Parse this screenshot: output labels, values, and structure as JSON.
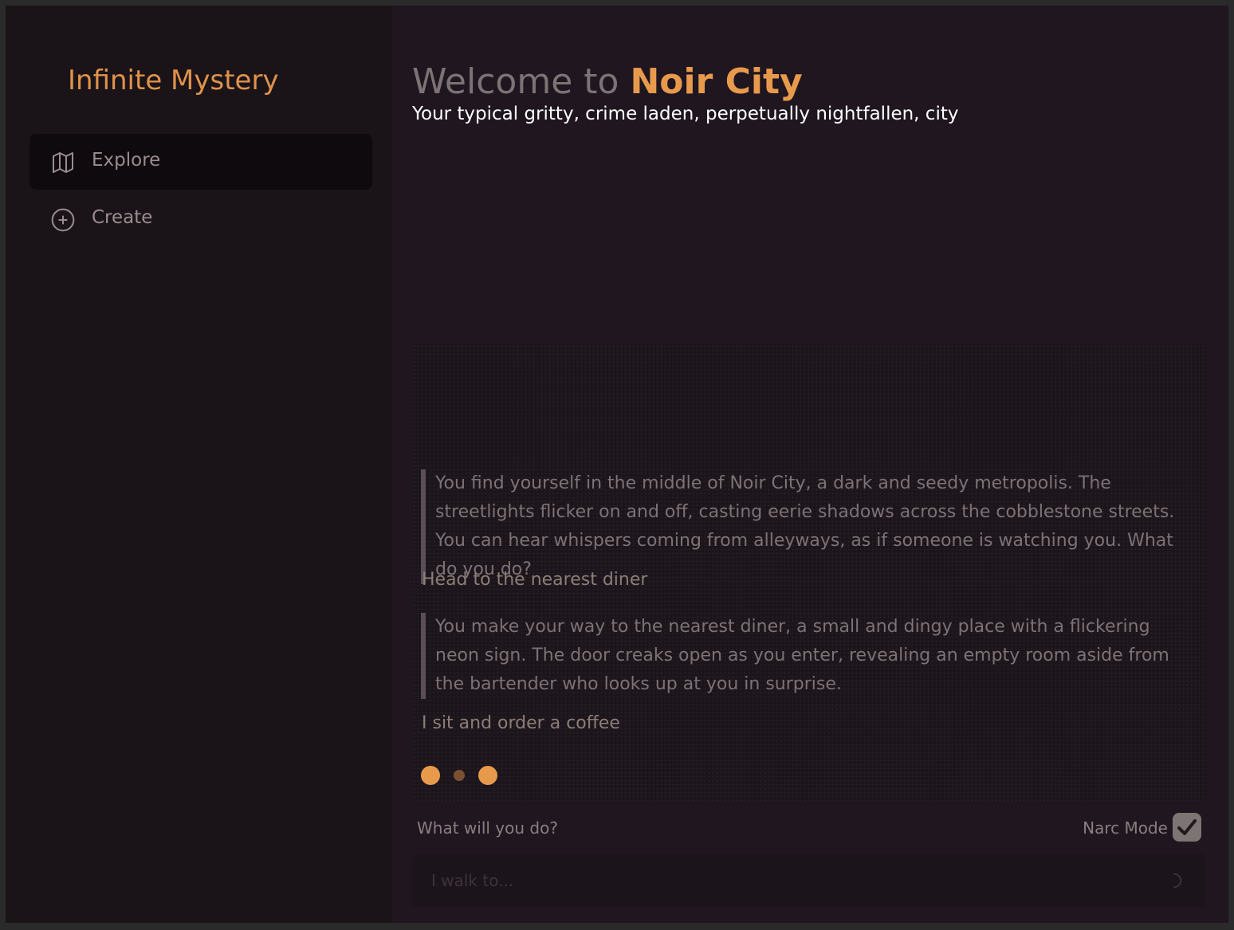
{
  "sidebar": {
    "app_title": "Infinite Mystery",
    "nav": [
      {
        "label": "Explore",
        "icon": "map-icon",
        "active": true
      },
      {
        "label": "Create",
        "icon": "plus-circle-icon",
        "active": false
      }
    ]
  },
  "header": {
    "welcome_prefix": "Welcome to",
    "city_name": "Noir City",
    "tagline": "Your typical gritty, crime laden, perpetually nightfallen, city"
  },
  "story": {
    "entries": [
      {
        "type": "narration",
        "text": "You find yourself in the middle of Noir City, a dark and seedy metropolis. The streetlights flicker on and off, casting eerie shadows across the cobblestone streets. You can hear whispers coming from alleyways, as if someone is watching you. What do you do?"
      },
      {
        "type": "action",
        "text": "Head to the nearest diner"
      },
      {
        "type": "narration",
        "text": "You make your way to the nearest diner, a small and dingy place with a flickering neon sign. The door creaks open as you enter, revealing an empty room aside from the bartender who looks up at you in surprise."
      },
      {
        "type": "action",
        "text": "I sit and order a coffee"
      }
    ],
    "loading": true
  },
  "input": {
    "prompt_label": "What will you do?",
    "placeholder": "I walk to...",
    "value": "",
    "narc_mode_label": "Narc Mode",
    "narc_mode_checked": true
  },
  "colors": {
    "accent": "#e89a4c",
    "background": "#1f1620",
    "sidebar": "#1a1419"
  }
}
